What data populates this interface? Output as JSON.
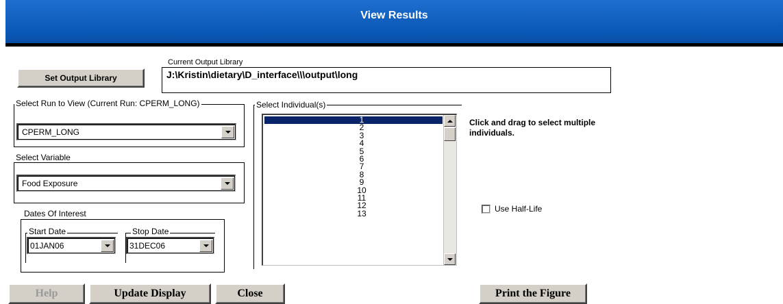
{
  "window": {
    "title": "View Results"
  },
  "output_library": {
    "button_label": "Set Output Library",
    "group_label": "Current Output Library",
    "path": "J:\\Kristin\\dietary\\D_interface\\\\\\output\\long"
  },
  "run": {
    "group_label": "Select Run to View (Current Run: CPERM_LONG)",
    "selected": "CPERM_LONG"
  },
  "variable": {
    "group_label": "Select Variable",
    "selected": "Food Exposure"
  },
  "dates": {
    "group_label": "Dates Of Interest",
    "start_label": "Start Date",
    "start_value": "01JAN06",
    "stop_label": "Stop Date",
    "stop_value": "31DEC06"
  },
  "individuals": {
    "group_label": "Select Individual(s)",
    "items": [
      "1",
      "2",
      "3",
      "4",
      "5",
      "6",
      "7",
      "8",
      "9",
      "10",
      "11",
      "12",
      "13"
    ],
    "selected_index": 0,
    "hint": "Click and drag to select multiple individuals."
  },
  "half_life": {
    "label": "Use Half-Life",
    "checked": false
  },
  "buttons": {
    "help": "Help",
    "update": "Update Display",
    "close": "Close",
    "print": "Print the Figure"
  },
  "colors": {
    "titlebar": "#0a59b8",
    "selection": "#0a246a",
    "button_face": "#d4d0c8"
  }
}
